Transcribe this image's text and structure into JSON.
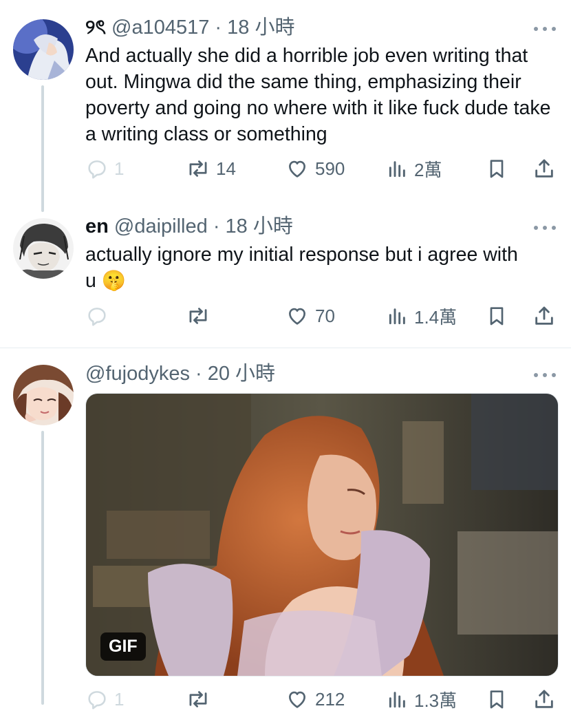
{
  "tweets": [
    {
      "display_name": "୨ৎ",
      "handle_meta": "@a104517 · 18 小時",
      "text": "And actually she did a horrible job even writing that out. Mingwa did the same thing, emphasizing their poverty and going no where with it like fuck dude take a writing class or something",
      "reply_count": "1",
      "retweet_count": "14",
      "like_count": "590",
      "view_count": "2萬"
    },
    {
      "display_name": "en",
      "handle_meta": "@daipilled · 18 小時",
      "text": "actually ignore my initial response but i agree with u 🤫",
      "reply_count": "",
      "retweet_count": "",
      "like_count": "70",
      "view_count": "1.4萬"
    },
    {
      "display_name": "",
      "handle_meta": "@fujodykes · 20 小時",
      "media_badge": "GIF",
      "reply_count": "1",
      "retweet_count": "",
      "like_count": "212",
      "view_count": "1.3萬"
    }
  ],
  "icons": [
    "more-icon",
    "reply-icon",
    "retweet-icon",
    "like-icon",
    "views-icon",
    "bookmark-icon",
    "share-icon"
  ],
  "colors": {
    "text": "#0f1419",
    "secondary": "#536471",
    "thread_line": "#cfd9de",
    "divider": "#e6ecf0"
  }
}
